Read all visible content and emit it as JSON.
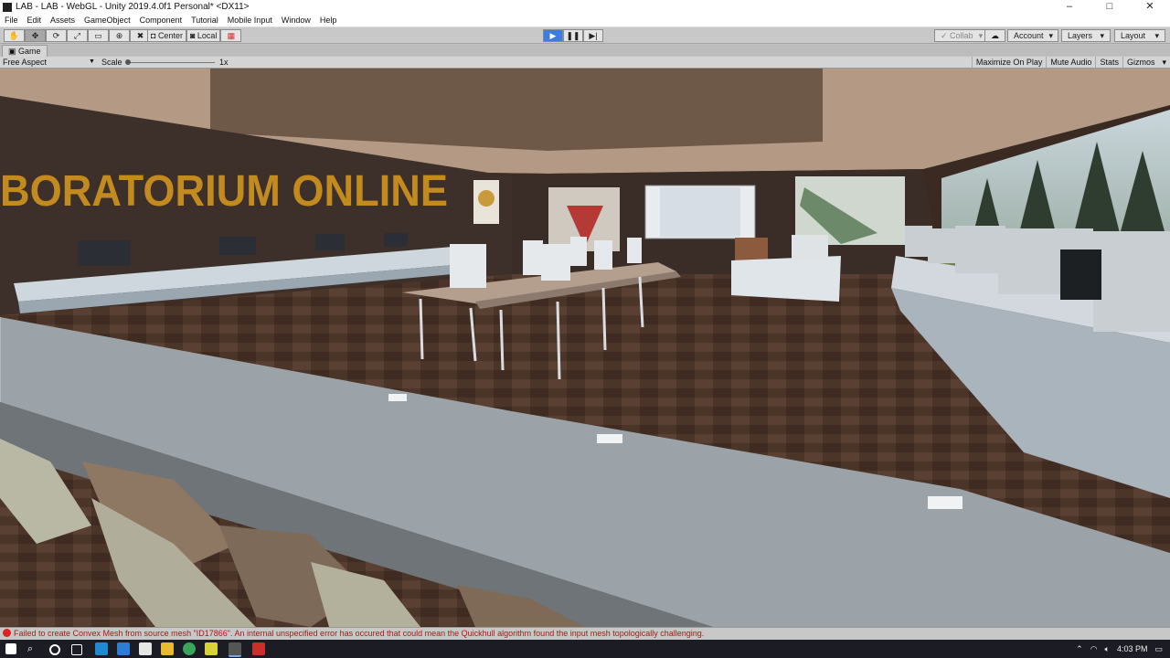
{
  "window": {
    "title": "LAB - LAB - WebGL - Unity 2019.4.0f1 Personal* <DX11>",
    "controls": [
      "–",
      "□",
      "✕"
    ]
  },
  "menu": [
    "File",
    "Edit",
    "Assets",
    "GameObject",
    "Component",
    "Tutorial",
    "Mobile Input",
    "Window",
    "Help"
  ],
  "toolbar": {
    "tools": [
      {
        "name": "hand-tool-button",
        "icon": "hand-icon",
        "glyph": "✋"
      },
      {
        "name": "move-tool-button",
        "icon": "move-icon",
        "glyph": "✥"
      },
      {
        "name": "rotate-tool-button",
        "icon": "rotate-icon",
        "glyph": "⟳"
      },
      {
        "name": "scale-tool-button",
        "icon": "scale-icon",
        "glyph": "⤢"
      },
      {
        "name": "rect-tool-button",
        "icon": "rect-icon",
        "glyph": "▭"
      },
      {
        "name": "transform-tool-button",
        "icon": "transform-icon",
        "glyph": "⊕"
      },
      {
        "name": "custom-tool-button",
        "icon": "wrench-icon",
        "glyph": "✖"
      }
    ],
    "pivot_label": "Center",
    "space_label": "Local",
    "collab_label": "Collab",
    "account_label": "Account",
    "layers_label": "Layers",
    "layout_label": "Layout"
  },
  "game_tab": {
    "label": "Game"
  },
  "game_bar": {
    "aspect": "Free Aspect",
    "scale_label": "Scale",
    "scale_value": "1x",
    "buttons": [
      "Maximize On Play",
      "Mute Audio",
      "Stats",
      "Gizmos"
    ]
  },
  "scene": {
    "wall_text": "BORATORIUM ONLINE"
  },
  "console": {
    "message": "Failed to create Convex Mesh from source mesh \"ID17866\". An internal unspecified error has occured that could mean the Quickhull algorithm found the input mesh topologically challenging."
  },
  "taskbar": {
    "time": "4:03 PM"
  },
  "colors": {
    "accent": "#3e7de0",
    "error": "#b31313"
  }
}
